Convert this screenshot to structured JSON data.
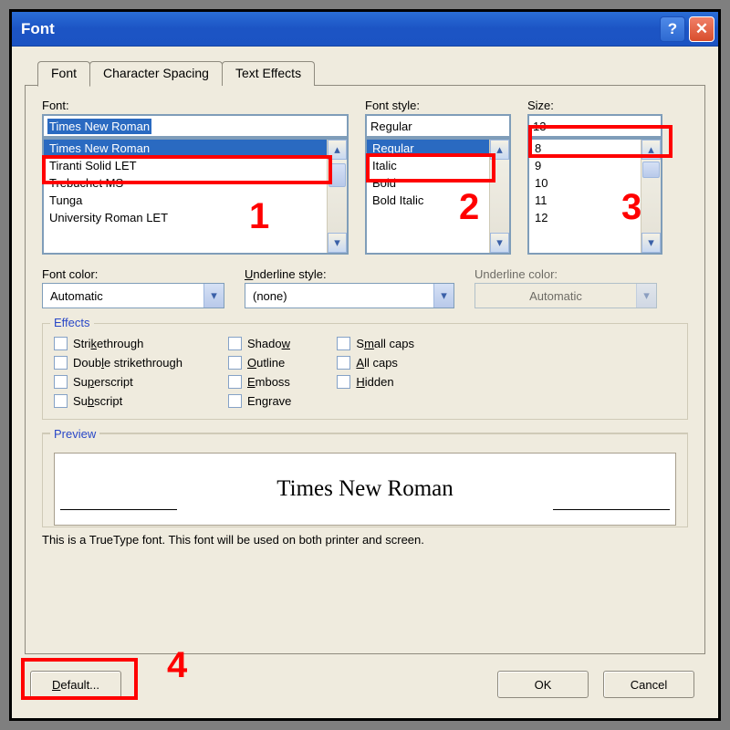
{
  "title": "Font",
  "tabs": [
    "Font",
    "Character Spacing",
    "Text Effects"
  ],
  "font_label": "Font:",
  "font_value": "Times New Roman",
  "font_list": [
    "Times New Roman",
    "Tiranti Solid LET",
    "Trebuchet MS",
    "Tunga",
    "University Roman LET"
  ],
  "style_label": "Font style:",
  "style_value": "Regular",
  "style_list": [
    "Regular",
    "Italic",
    "Bold",
    "Bold Italic"
  ],
  "size_label": "Size:",
  "size_value": "13",
  "size_list": [
    "8",
    "9",
    "10",
    "11",
    "12"
  ],
  "color_label": "Font color:",
  "color_value": "Automatic",
  "uline_label": "Underline style:",
  "uline_value": "(none)",
  "ucolor_label": "Underline color:",
  "ucolor_value": "Automatic",
  "effects_legend": "Effects",
  "effects_col1": [
    "Strikethrough",
    "Double strikethrough",
    "Superscript",
    "Subscript"
  ],
  "effects_col2": [
    "Shadow",
    "Outline",
    "Emboss",
    "Engrave"
  ],
  "effects_col3": [
    "Small caps",
    "All caps",
    "Hidden"
  ],
  "preview_legend": "Preview",
  "preview_text": "Times New Roman",
  "note": "This is a TrueType font. This font will be used on both printer and screen.",
  "buttons": {
    "default": "Default...",
    "ok": "OK",
    "cancel": "Cancel"
  },
  "callouts": {
    "n1": "1",
    "n2": "2",
    "n3": "3",
    "n4": "4"
  }
}
